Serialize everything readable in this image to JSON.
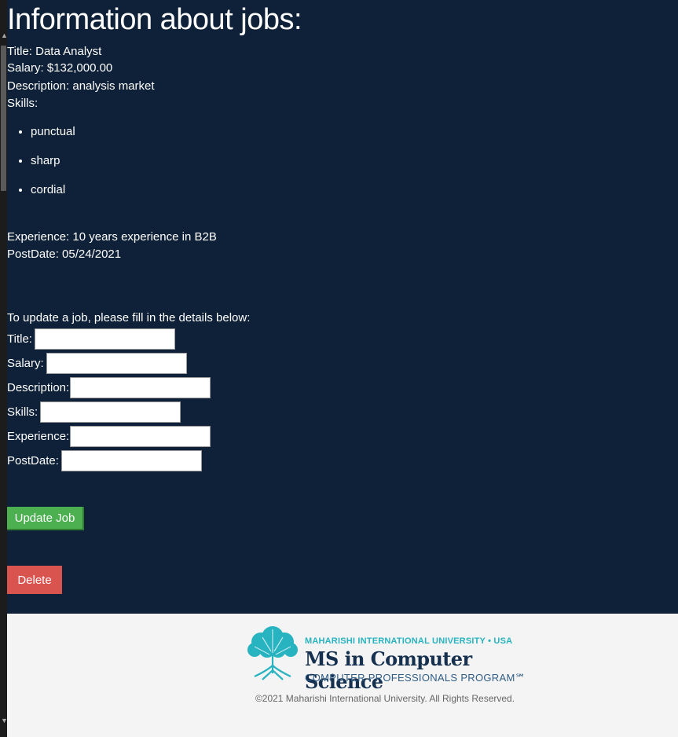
{
  "job": {
    "heading": "Information about jobs:",
    "title_line": "Title: Data Analyst",
    "salary_line": "Salary: $132,000.00",
    "description_line": "Description: analysis market",
    "skills_label": "Skills:",
    "skills": [
      "punctual",
      "sharp",
      "cordial"
    ],
    "experience_line": "Experience: 10 years experience in B2B",
    "postdate_line": "PostDate: 05/24/2021"
  },
  "form": {
    "intro": "To update a job, please fill in the details below:",
    "title_label": "Title:",
    "salary_label": "Salary:",
    "description_label": "Description:",
    "skills_label": "Skills:",
    "experience_label": "Experience:",
    "postdate_label": "PostDate:",
    "update_button": "Update Job",
    "delete_button": "Delete"
  },
  "footer": {
    "university": "MAHARISHI INTERNATIONAL UNIVERSITY • USA",
    "program_title": "MS in Computer Science",
    "program_subtitle": "COMPUTER PROFESSIONALS PROGRAM℠",
    "copyright": "©2021 Maharishi International University. All Rights Reserved."
  },
  "colors": {
    "page_bg": "#0f2138",
    "footer_bg": "#f4f4f4",
    "update_button": "#4caf50",
    "delete_button": "#d9534f",
    "logo_teal": "#27b3c0",
    "logo_navy": "#16304f"
  },
  "icons": {
    "logo_tree": "tree-icon"
  }
}
